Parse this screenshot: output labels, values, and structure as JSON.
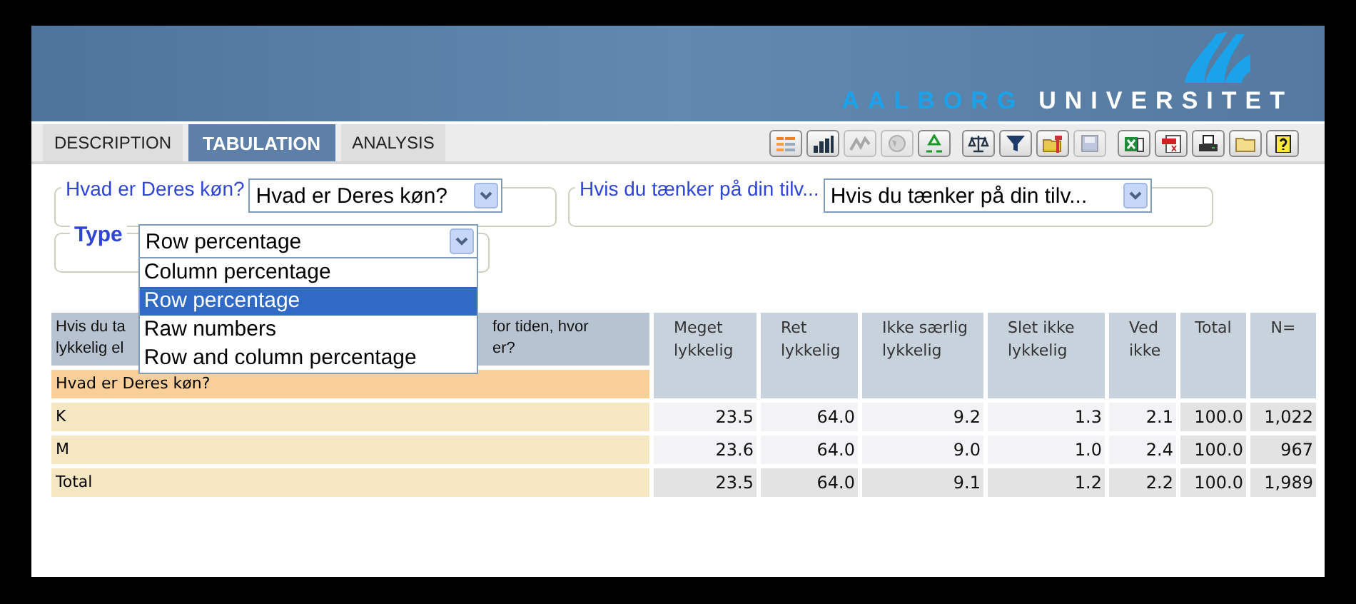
{
  "header": {
    "logo_word_1": "AALBORG",
    "logo_word_2": "UNIVERSITET"
  },
  "tabs": [
    {
      "label": "DESCRIPTION",
      "selected": false
    },
    {
      "label": "TABULATION",
      "selected": true
    },
    {
      "label": "ANALYSIS",
      "selected": false
    }
  ],
  "toolbar": {
    "groups": [
      [
        {
          "disabled": false
        },
        {
          "disabled": false
        },
        {
          "disabled": true
        },
        {
          "disabled": true
        },
        {
          "disabled": false
        }
      ],
      [
        {
          "disabled": false
        },
        {
          "disabled": false
        },
        {
          "disabled": false
        },
        {
          "disabled": true
        }
      ],
      [
        {
          "disabled": false
        },
        {
          "disabled": false
        },
        {
          "disabled": false
        },
        {
          "disabled": false
        },
        {
          "disabled": false
        }
      ]
    ]
  },
  "filters": [
    {
      "legend": "Hvad er Deres køn?",
      "value": "Hvad er Deres køn?"
    },
    {
      "legend": "Hvis du tænker på din tilv...",
      "value": "Hvis du tænker på din tilv..."
    }
  ],
  "type_filter": {
    "legend": "Type",
    "value": "Row percentage",
    "expanded": true,
    "options": [
      {
        "label": "Column percentage",
        "selected": false
      },
      {
        "label": "Row percentage",
        "selected": true
      },
      {
        "label": "Raw numbers",
        "selected": false
      },
      {
        "label": "Row and column percentage",
        "selected": false
      }
    ]
  },
  "table": {
    "row_header": {
      "left_lines": [
        "Hvis du ta",
        "lykkelig el"
      ],
      "right_lines": [
        "for tiden, hvor",
        "er?"
      ]
    },
    "columns": [
      "Meget lykkelig",
      "Ret lykkelig",
      "Ikke særlig lykkelig",
      "Slet ikke lykkelig",
      "Ved ikke",
      "Total",
      "N="
    ],
    "group": "Hvad er Deres køn?",
    "rows": [
      {
        "label": "K",
        "cells": [
          "23.5",
          "64.0",
          "9.2",
          "1.3",
          "2.1",
          "100.0",
          "1,022"
        ]
      },
      {
        "label": "M",
        "cells": [
          "23.6",
          "64.0",
          "9.0",
          "1.0",
          "2.4",
          "100.0",
          "967"
        ]
      },
      {
        "label": "Total",
        "kind": "total",
        "cells": [
          "23.5",
          "64.0",
          "9.1",
          "1.2",
          "2.2",
          "100.0",
          "1,989"
        ]
      }
    ]
  }
}
